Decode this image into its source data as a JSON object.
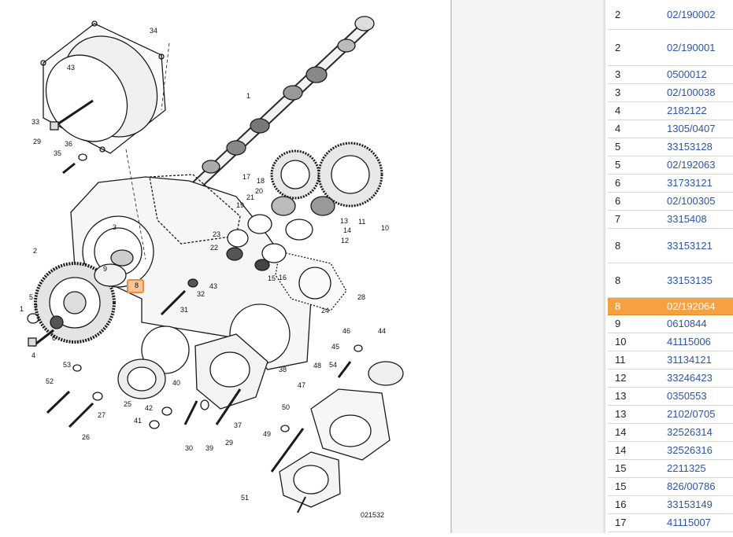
{
  "diagram": {
    "drawing_number": "021532",
    "selected_callout": "8",
    "callouts": [
      "34",
      "43",
      "33",
      "29",
      "1",
      "36",
      "35",
      "17",
      "18",
      "20",
      "21",
      "19",
      "13",
      "11",
      "14",
      "10",
      "12",
      "23",
      "22",
      "16",
      "15",
      "2",
      "3",
      "9",
      "8",
      "5",
      "7",
      "1",
      "6",
      "4",
      "43",
      "32",
      "31",
      "28",
      "24",
      "46",
      "45",
      "44",
      "54",
      "48",
      "47",
      "53",
      "52",
      "25",
      "27",
      "26",
      "40",
      "42",
      "41",
      "30",
      "39",
      "29",
      "37",
      "38",
      "50",
      "49",
      "51"
    ]
  },
  "parts_table": {
    "rows": [
      {
        "qty": "2",
        "part": "02/190002",
        "selected": false
      },
      {
        "qty": "2",
        "part": "02/190001",
        "selected": false
      },
      {
        "qty": "3",
        "part": "0500012",
        "selected": false
      },
      {
        "qty": "3",
        "part": "02/100038",
        "selected": false
      },
      {
        "qty": "4",
        "part": "2182122",
        "selected": false
      },
      {
        "qty": "4",
        "part": "1305/0407",
        "selected": false
      },
      {
        "qty": "5",
        "part": "33153128",
        "selected": false
      },
      {
        "qty": "5",
        "part": "02/192063",
        "selected": false
      },
      {
        "qty": "6",
        "part": "31733121",
        "selected": false
      },
      {
        "qty": "6",
        "part": "02/100305",
        "selected": false
      },
      {
        "qty": "7",
        "part": "3315408",
        "selected": false
      },
      {
        "qty": "8",
        "part": "33153121",
        "selected": false
      },
      {
        "qty": "8",
        "part": "33153135",
        "selected": false
      },
      {
        "qty": "8",
        "part": "02/192064",
        "selected": true
      },
      {
        "qty": "9",
        "part": "0610844",
        "selected": false
      },
      {
        "qty": "10",
        "part": "41115006",
        "selected": false
      },
      {
        "qty": "11",
        "part": "31134121",
        "selected": false
      },
      {
        "qty": "12",
        "part": "33246423",
        "selected": false
      },
      {
        "qty": "13",
        "part": "0350553",
        "selected": false
      },
      {
        "qty": "13",
        "part": "2102/0705",
        "selected": false
      },
      {
        "qty": "14",
        "part": "32526314",
        "selected": false
      },
      {
        "qty": "14",
        "part": "32526316",
        "selected": false
      },
      {
        "qty": "15",
        "part": "2211325",
        "selected": false
      },
      {
        "qty": "15",
        "part": "826/00786",
        "selected": false
      },
      {
        "qty": "16",
        "part": "33153149",
        "selected": false
      },
      {
        "qty": "17",
        "part": "41115007",
        "selected": false
      }
    ]
  },
  "colors": {
    "selected_row_bg": "#f5a142",
    "link_text": "#2c54a8",
    "callout_highlight": "#f08a3c"
  }
}
